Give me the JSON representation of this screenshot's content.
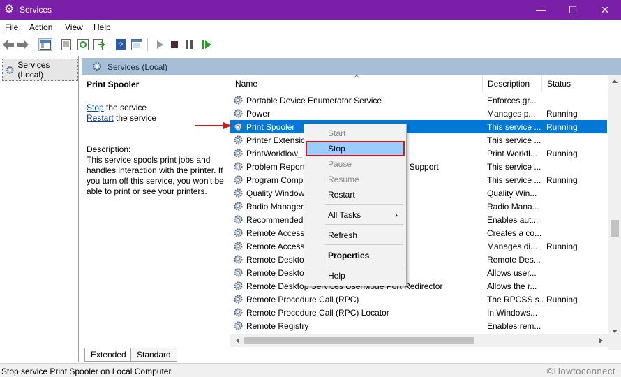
{
  "window": {
    "title": "Services",
    "icon": "gear-icon",
    "controls": {
      "minimize": "—",
      "maximize": "☐",
      "close": "✕"
    }
  },
  "menubar": [
    {
      "key": "F",
      "rest": "ile"
    },
    {
      "key": "A",
      "rest": "ction"
    },
    {
      "key": "V",
      "rest": "iew"
    },
    {
      "key": "H",
      "rest": "elp"
    }
  ],
  "toolbar": {
    "icons": [
      "back-icon",
      "forward-icon",
      "show-hide-tree-icon",
      "properties-icon",
      "refresh-icon",
      "export-icon",
      "help-icon",
      "console-icon",
      "start-icon",
      "stop-icon",
      "pause-icon",
      "restart-icon"
    ]
  },
  "tree": {
    "root_label": "Services (Local)"
  },
  "pane_header": {
    "label": "Services (Local)"
  },
  "details": {
    "service_name": "Print Spooler",
    "stop_link": "Stop",
    "stop_rest": " the service",
    "restart_link": "Restart",
    "restart_rest": " the service",
    "description_label": "Description:",
    "description_text": "This service spools print jobs and handles interaction with the printer. If you turn off this service, you won't be able to print or see your printers."
  },
  "columns": {
    "name": "Name",
    "description": "Description",
    "status": "Status"
  },
  "rows": [
    {
      "name": "Portable Device Enumerator Service",
      "description": "Enforces gr...",
      "status": ""
    },
    {
      "name": "Power",
      "description": "Manages p...",
      "status": "Running"
    },
    {
      "name": "Print Spooler",
      "description": "This service ...",
      "status": "Running",
      "selected": true
    },
    {
      "name": "Printer Extensio",
      "description": "This service ...",
      "status": ""
    },
    {
      "name": "PrintWorkflow_",
      "description": "Print Workfl...",
      "status": "Running"
    },
    {
      "name": "Problem Report",
      "name_tail": "el Support",
      "description": "This service ...",
      "status": ""
    },
    {
      "name": "Program Comp",
      "description": "This service ...",
      "status": "Running"
    },
    {
      "name": "Quality Window",
      "description": "Quality Win...",
      "status": ""
    },
    {
      "name": "Radio Managen",
      "description": "Radio Mana...",
      "status": ""
    },
    {
      "name": "Recommended",
      "description": "Enables aut...",
      "status": ""
    },
    {
      "name": "Remote Access",
      "description": "Creates a co...",
      "status": ""
    },
    {
      "name": "Remote Access",
      "description": "Manages di...",
      "status": "Running"
    },
    {
      "name": "Remote Desktop",
      "description": "Remote Des...",
      "status": ""
    },
    {
      "name": "Remote Desktop",
      "description": "Allows user...",
      "status": ""
    },
    {
      "name": "Remote Desktop Services UserMode Port Redirector",
      "description": "Allows the r...",
      "status": ""
    },
    {
      "name": "Remote Procedure Call (RPC)",
      "description": "The RPCSS s...",
      "status": "Running"
    },
    {
      "name": "Remote Procedure Call (RPC) Locator",
      "description": "In Windows...",
      "status": ""
    },
    {
      "name": "Remote Registry",
      "description": "Enables rem...",
      "status": ""
    }
  ],
  "context_menu": [
    {
      "label": "Start",
      "disabled": true
    },
    {
      "label": "Stop",
      "highlighted": true
    },
    {
      "label": "Pause",
      "disabled": true
    },
    {
      "label": "Resume",
      "disabled": true
    },
    {
      "label": "Restart"
    },
    {
      "label": "All Tasks",
      "submenu": "›"
    },
    {
      "label": "Refresh"
    },
    {
      "label": "Properties",
      "bold": true
    },
    {
      "label": "Help"
    }
  ],
  "tabs": {
    "extended": "Extended",
    "standard": "Standard"
  },
  "statusbar": {
    "text": "Stop service Print Spooler on Local Computer",
    "watermark": "©Howtoconnect"
  },
  "colors": {
    "titlebar": "#7a1fa8",
    "selection": "#0078d7",
    "menu_highlight": "#99ccff",
    "annotation": "#d01a1a"
  }
}
